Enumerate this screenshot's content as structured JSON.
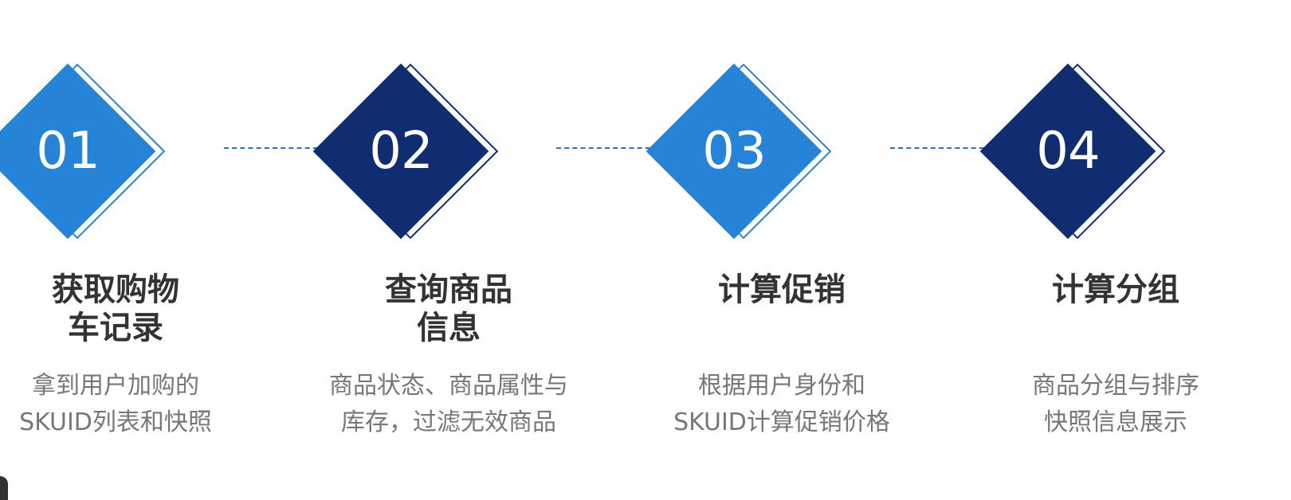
{
  "colors": {
    "light_blue": "#2583d8",
    "dark_blue": "#0f2d70",
    "title_text": "#333333",
    "desc_text": "#777777",
    "connector": "#3a6fa8"
  },
  "steps": [
    {
      "number": "01",
      "title": "获取购物\n车记录",
      "desc": "拿到用户加购的\nSKUID列表和快照",
      "color": "#2583d8"
    },
    {
      "number": "02",
      "title": "查询商品\n信息",
      "desc": "商品状态、商品属性与\n库存，过滤无效商品",
      "color": "#0f2d70"
    },
    {
      "number": "03",
      "title": "计算促销",
      "desc": "根据用户身份和\nSKUID计算促销价格",
      "color": "#2583d8"
    },
    {
      "number": "04",
      "title": "计算分组",
      "desc": "商品分组与排序\n快照信息展示",
      "color": "#0f2d70"
    }
  ]
}
